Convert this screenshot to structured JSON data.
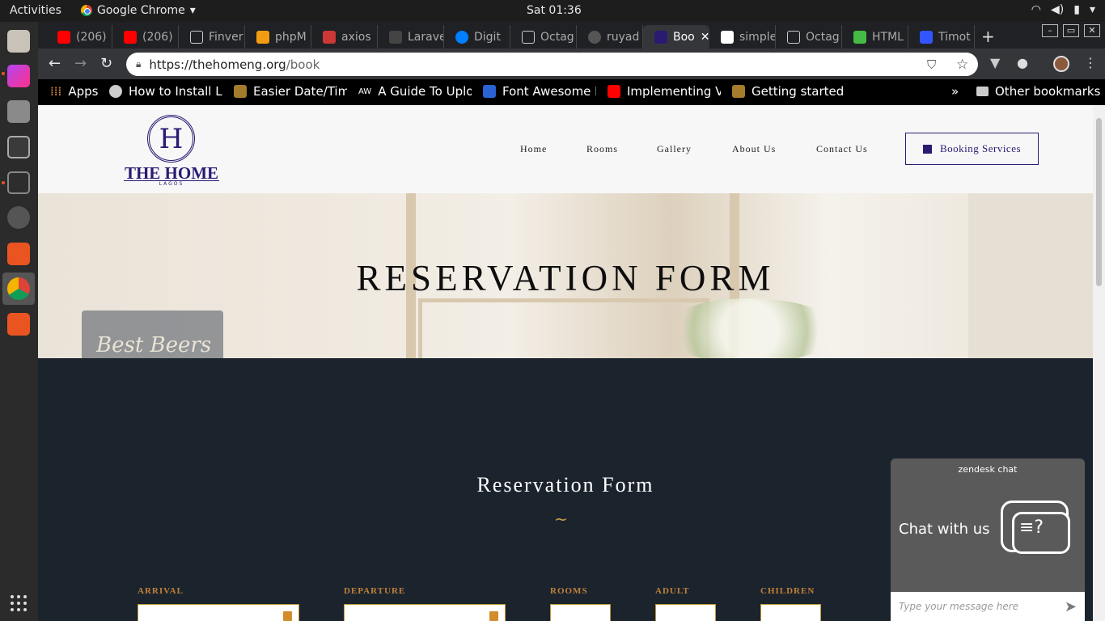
{
  "topbar": {
    "activities": "Activities",
    "app_name": "Google Chrome",
    "clock": "Sat 01:36"
  },
  "tabs": [
    {
      "label": "(206)",
      "color": "#ff0000"
    },
    {
      "label": "(206)",
      "color": "#ff0000"
    },
    {
      "label": "Finver",
      "color": "#ffffff"
    },
    {
      "label": "phpM",
      "color": "#f39c12"
    },
    {
      "label": "axios",
      "color": "#cb3837"
    },
    {
      "label": "Larave",
      "color": "#888888"
    },
    {
      "label": "Digit",
      "color": "#0080ff"
    },
    {
      "label": "Octag",
      "color": "#ffffff"
    },
    {
      "label": "ruyad",
      "color": "#888888"
    },
    {
      "label": "Boo",
      "color": "#2b1a72"
    },
    {
      "label": "simple",
      "color": "#ffffff"
    },
    {
      "label": "Octag",
      "color": "#ffffff"
    },
    {
      "label": "HTML",
      "color": "#44bb44"
    },
    {
      "label": "Timot",
      "color": "#3355ff"
    }
  ],
  "omnibox": {
    "host": "https://thehomeng.org",
    "path": "/book"
  },
  "bookmarks": [
    {
      "label": "Apps"
    },
    {
      "label": "How to Install La"
    },
    {
      "label": "Easier Date/Time"
    },
    {
      "label": "A Guide To Uploa"
    },
    {
      "label": "Font Awesome Ic"
    },
    {
      "label": "Implementing Vu"
    },
    {
      "label": "Getting started v"
    }
  ],
  "bookmarks_overflow": "»",
  "other_bookmarks": "Other bookmarks",
  "site": {
    "logo": {
      "letter": "H",
      "name": "THE HOME",
      "sub": "LAGOS"
    },
    "nav": [
      "Home",
      "Rooms",
      "Gallery",
      "About Us",
      "Contact Us"
    ],
    "booking_button": "Booking Services",
    "hero_title": "RESERVATION FORM",
    "hero_plaque": "Best Beers",
    "form_title": "Reservation Form",
    "divider": "~",
    "fields": [
      "ARRIVAL",
      "DEPARTURE",
      "ROOMS",
      "ADULT",
      "CHILDREN"
    ],
    "accent_color": "#2b1a72",
    "label_color": "#c0803a"
  },
  "zendesk": {
    "brand": "zendesk chat",
    "title": "Chat with us",
    "placeholder": "Type your message here"
  }
}
